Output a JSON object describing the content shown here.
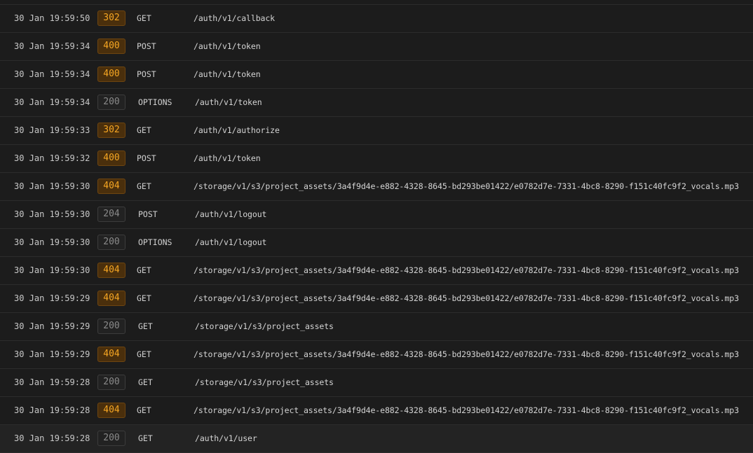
{
  "colors": {
    "background": "#1c1c1c",
    "warn_badge_bg": "#4a2f0c",
    "warn_badge_text": "#f5a623",
    "ok_badge_bg": "#222222",
    "ok_badge_text": "#8a8a8a"
  },
  "logs": [
    {
      "timestamp": "30 Jan 19:59:50",
      "status": "302",
      "method": "GET",
      "path": "/auth/v1/callback"
    },
    {
      "timestamp": "30 Jan 19:59:34",
      "status": "400",
      "method": "POST",
      "path": "/auth/v1/token"
    },
    {
      "timestamp": "30 Jan 19:59:34",
      "status": "400",
      "method": "POST",
      "path": "/auth/v1/token"
    },
    {
      "timestamp": "30 Jan 19:59:34",
      "status": "200",
      "method": "OPTIONS",
      "path": "/auth/v1/token"
    },
    {
      "timestamp": "30 Jan 19:59:33",
      "status": "302",
      "method": "GET",
      "path": "/auth/v1/authorize"
    },
    {
      "timestamp": "30 Jan 19:59:32",
      "status": "400",
      "method": "POST",
      "path": "/auth/v1/token"
    },
    {
      "timestamp": "30 Jan 19:59:30",
      "status": "404",
      "method": "GET",
      "path": "/storage/v1/s3/project_assets/3a4f9d4e-e882-4328-8645-bd293be01422/e0782d7e-7331-4bc8-8290-f151c40fc9f2_vocals.mp3"
    },
    {
      "timestamp": "30 Jan 19:59:30",
      "status": "204",
      "method": "POST",
      "path": "/auth/v1/logout"
    },
    {
      "timestamp": "30 Jan 19:59:30",
      "status": "200",
      "method": "OPTIONS",
      "path": "/auth/v1/logout"
    },
    {
      "timestamp": "30 Jan 19:59:30",
      "status": "404",
      "method": "GET",
      "path": "/storage/v1/s3/project_assets/3a4f9d4e-e882-4328-8645-bd293be01422/e0782d7e-7331-4bc8-8290-f151c40fc9f2_vocals.mp3"
    },
    {
      "timestamp": "30 Jan 19:59:29",
      "status": "404",
      "method": "GET",
      "path": "/storage/v1/s3/project_assets/3a4f9d4e-e882-4328-8645-bd293be01422/e0782d7e-7331-4bc8-8290-f151c40fc9f2_vocals.mp3"
    },
    {
      "timestamp": "30 Jan 19:59:29",
      "status": "200",
      "method": "GET",
      "path": "/storage/v1/s3/project_assets"
    },
    {
      "timestamp": "30 Jan 19:59:29",
      "status": "404",
      "method": "GET",
      "path": "/storage/v1/s3/project_assets/3a4f9d4e-e882-4328-8645-bd293be01422/e0782d7e-7331-4bc8-8290-f151c40fc9f2_vocals.mp3"
    },
    {
      "timestamp": "30 Jan 19:59:28",
      "status": "200",
      "method": "GET",
      "path": "/storage/v1/s3/project_assets"
    },
    {
      "timestamp": "30 Jan 19:59:28",
      "status": "404",
      "method": "GET",
      "path": "/storage/v1/s3/project_assets/3a4f9d4e-e882-4328-8645-bd293be01422/e0782d7e-7331-4bc8-8290-f151c40fc9f2_vocals.mp3"
    },
    {
      "timestamp": "30 Jan 19:59:28",
      "status": "200",
      "method": "GET",
      "path": "/auth/v1/user"
    }
  ]
}
